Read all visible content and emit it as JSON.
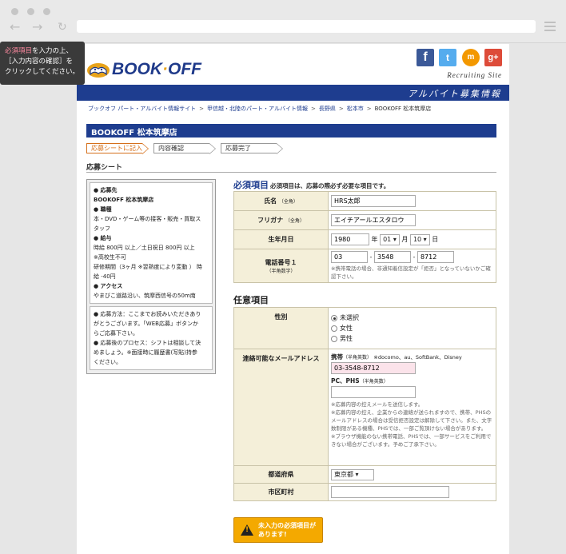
{
  "tooltip": {
    "req": "必須項目",
    "line1": "を入力の上、",
    "line2": "［入力内容の確認］を",
    "line3": "クリックしてください。"
  },
  "header": {
    "logo": "BOOK",
    "logo_dot": "·",
    "logo2": "OFF",
    "recruiting": "Recruiting Site",
    "banner": "アルバイト募集情報"
  },
  "breadcrumb": [
    "ブックオフ パート・アルバイト情報サイト",
    "甲信越・北陸のパート・アルバイト情報",
    "長野県",
    "松本市",
    "BOOKOFF 松本筑摩店"
  ],
  "store_title": "BOOKOFF 松本筑摩店",
  "steps": [
    "応募シートに記入",
    "内容確認",
    "応募完了"
  ],
  "section_title": "応募シート",
  "info": {
    "l1": "● 応募先",
    "l2": "BOOKOFF 松本筑摩店",
    "l3": "● 職種",
    "l4": "本・DVD・ゲーム等の接客・販売・買取ス",
    "l5": "タッフ",
    "l6": "● 給与",
    "l7": "時給 800円 以上／土日祝日 800円 以上",
    "l8": "※高校生不可",
    "l9": "研修期間（3ヶ月 ※習熟度により変動 ） 時",
    "l10": "給 -40円",
    "l11": "● アクセス",
    "l12": "やまびこ道路沿い、筑摩西信号の50m南",
    "m1": "● 応募方法：ここまでお読みいただきあり",
    "m2": "がとうございます。「WEB応募」ボタンか",
    "m3": "らご応募下さい。",
    "m4": "● 応募後のプロセス：シフトは相談して決",
    "m5": "めましょう。※面接時に履歴書(写貼)持参",
    "m6": "ください。"
  },
  "required": {
    "title": "必須項目",
    "subtitle": "必須項目は、応募の際必ず必要な項目です。",
    "name_label": "氏名",
    "name_note": "（全角）",
    "name_value": "HRS太郎",
    "kana_label": "フリガナ",
    "kana_note": "（全角）",
    "kana_value": "エイチアールエスタロウ",
    "birth_label": "生年月日",
    "birth_year": "1980",
    "year_unit": "年",
    "birth_month": "01",
    "month_unit": "月",
    "birth_day": "10",
    "day_unit": "日",
    "phone_label": "電話番号１",
    "phone_note": "（半角数字）",
    "phone1": "03",
    "phone2": "3548",
    "phone3": "8712",
    "dash": "-",
    "phone_help": "※携帯電話の場合、非通知着信設定が「拒否」となっていないかご確認下さい。"
  },
  "optional": {
    "title": "任意項目",
    "gender_label": "性別",
    "gender_options": [
      "未選択",
      "女性",
      "男性"
    ],
    "mail_label": "連絡可能なメールアドレス",
    "mobile_label": "携帯",
    "mobile_note": "（半角英数）",
    "mobile_carriers": "※docomo、au、SoftBank、Disney",
    "mobile_value": "03-3548-8712",
    "pc_label": "PC、PHS",
    "pc_note": "（半角英数）",
    "help1": "※応募内容の控えメールを送信します。",
    "help2": "※応募内容の控え、企業からの連絡が送られますので、携帯、PHSのメールアドレスの場合は受信拒否設定は解除して下さい。また、文字数制限がある機種、PHSでは、一部ご覧頂けない場合があります。",
    "help3": "※ブラウザ機能のない携帯電話、PHSでは、一部サービスをご利用できない場合がございます。予めご了承下さい。",
    "pref_label": "都道府県",
    "pref_value": "東京都",
    "city_label": "市区町村"
  },
  "warning": {
    "line1": "未入力の必須項目が",
    "line2": "あります!"
  },
  "colors": {
    "brand_blue": "#1e3d8f",
    "accent_orange": "#d5701b",
    "warn": "#f4a900"
  }
}
